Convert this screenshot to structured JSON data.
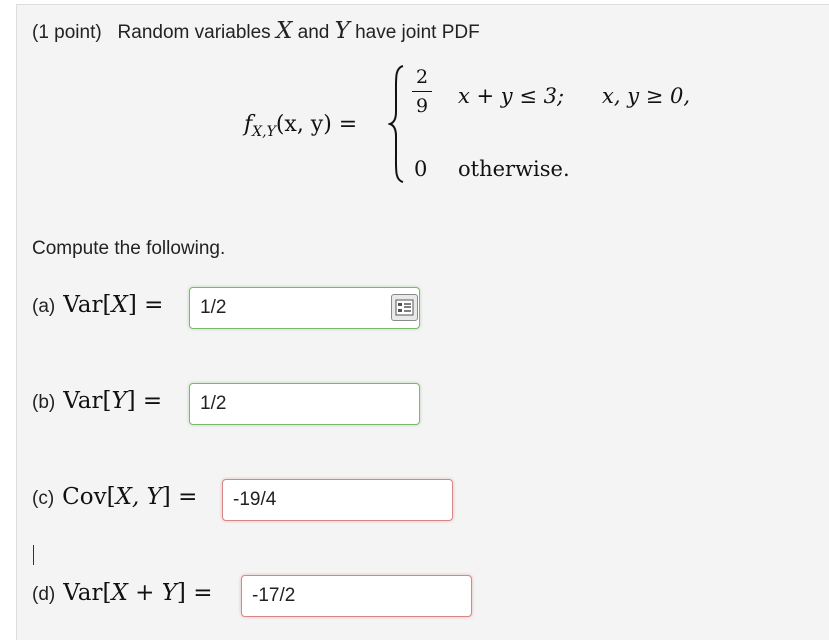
{
  "problem": {
    "points": "(1 point)",
    "intro_a": "Random variables",
    "var_x": "X",
    "intro_and": "and",
    "var_y": "Y",
    "intro_b": "have joint PDF"
  },
  "formula": {
    "lhs_f": "f",
    "lhs_sub": "X,Y",
    "lhs_args": "(x, y) =",
    "frac_num": "2",
    "frac_den": "9",
    "case1_cond_a": "x + y ≤ 3;",
    "case1_cond_b": "x, y ≥ 0,",
    "case2_value": "0",
    "case2_cond": "otherwise."
  },
  "instructions": "Compute the following.",
  "parts": [
    {
      "label": "(a)",
      "func": "Var",
      "arg": "X",
      "eq": "=",
      "value": "1/2",
      "status": "correct"
    },
    {
      "label": "(b)",
      "func": "Var",
      "arg": "Y",
      "eq": "=",
      "value": "1/2",
      "status": "correct"
    },
    {
      "label": "(c)",
      "func": "Cov",
      "arg": "X, Y",
      "eq": "=",
      "value": "-19/4",
      "status": "incorrect"
    },
    {
      "label": "(d)",
      "func": "Var",
      "arg": "X + Y",
      "eq": "=",
      "value": "-17/2",
      "status": "incorrect"
    }
  ],
  "icons": {
    "equation_palette": "equation-editor-icon"
  },
  "colors": {
    "correct_border": "#7bb86a",
    "incorrect_border": "#d98686",
    "panel_bg": "#f4f4f4"
  }
}
